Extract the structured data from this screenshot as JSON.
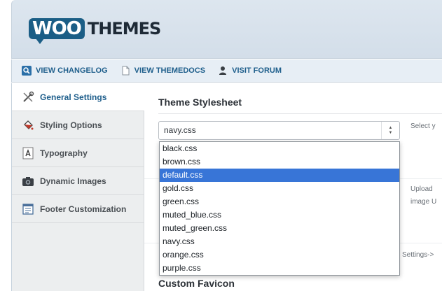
{
  "header": {
    "logo_woo": "WOO",
    "logo_themes": "THEMES"
  },
  "links": [
    {
      "label": "VIEW CHANGELOG",
      "icon": "magnifier-icon"
    },
    {
      "label": "VIEW THEMEDOCS",
      "icon": "document-icon"
    },
    {
      "label": "VISIT FORUM",
      "icon": "person-icon"
    }
  ],
  "sidebar": {
    "items": [
      {
        "label": "General Settings",
        "icon": "tools-icon",
        "active": true
      },
      {
        "label": "Styling Options",
        "icon": "paint-bucket-icon",
        "active": false
      },
      {
        "label": "Typography",
        "icon": "font-icon",
        "active": false
      },
      {
        "label": "Dynamic Images",
        "icon": "camera-icon",
        "active": false
      },
      {
        "label": "Footer Customization",
        "icon": "layout-icon",
        "active": false
      }
    ]
  },
  "main": {
    "section_title": "Theme Stylesheet",
    "select_value": "navy.css",
    "select_hint": "Select y",
    "upload_hint_1": "Upload",
    "upload_hint_2": "image U",
    "settings_hint": "Settings->",
    "next_section_title": "Custom Favicon"
  },
  "dropdown": {
    "options": [
      "black.css",
      "brown.css",
      "default.css",
      "gold.css",
      "green.css",
      "muted_blue.css",
      "muted_green.css",
      "navy.css",
      "orange.css",
      "purple.css"
    ],
    "highlighted": "default.css"
  },
  "colors": {
    "brand": "#1b5e86",
    "link": "#1f5f8c",
    "highlight": "#3875d7"
  }
}
